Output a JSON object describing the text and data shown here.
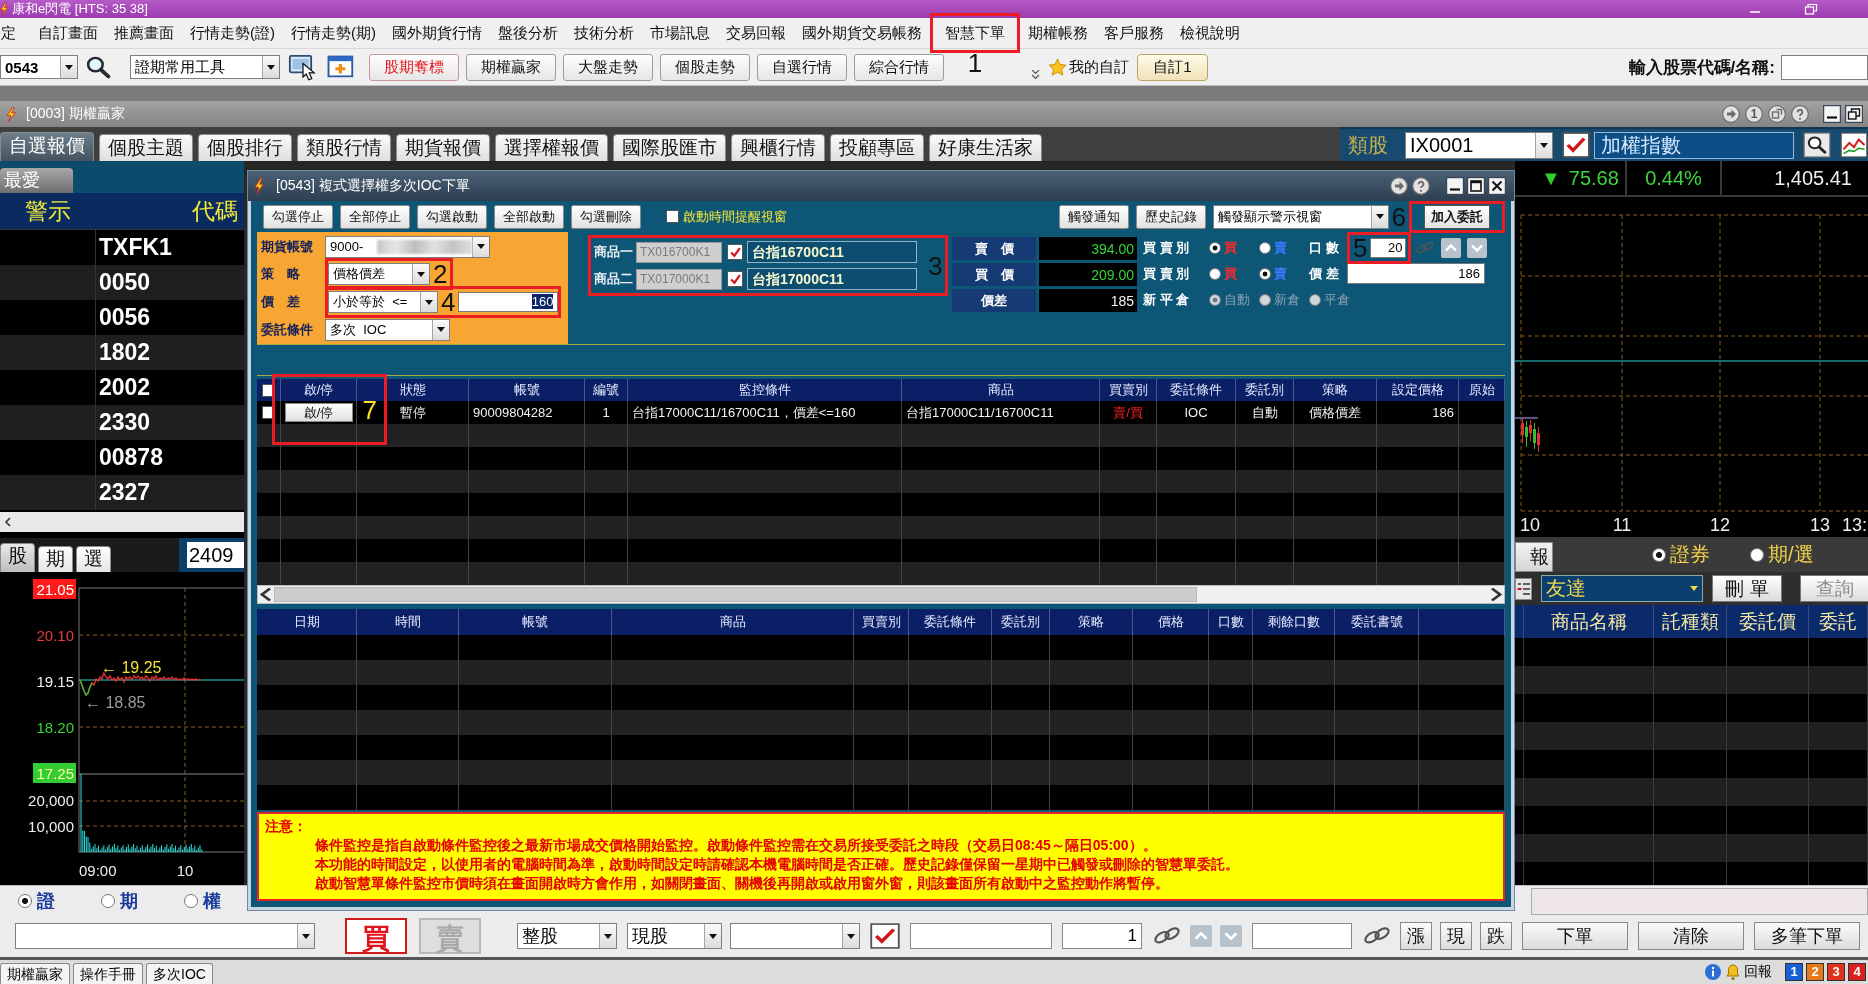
{
  "window": {
    "title": "康和e閃電 [HTS: 35 38]"
  },
  "menu": [
    {
      "label": "定"
    },
    {
      "label": "自訂畫面"
    },
    {
      "label": "推薦畫面"
    },
    {
      "label": "行情走勢(證)"
    },
    {
      "label": "行情走勢(期)"
    },
    {
      "label": "國外期貨行情"
    },
    {
      "label": "盤後分析"
    },
    {
      "label": "技術分析"
    },
    {
      "label": "市場訊息"
    },
    {
      "label": "交易回報"
    },
    {
      "label": "國外期貨交易帳務"
    },
    {
      "label": "智慧下單",
      "callout": "1"
    },
    {
      "label": "期權帳務"
    },
    {
      "label": "客戶服務"
    },
    {
      "label": "檢視說明"
    }
  ],
  "toolbar": {
    "code": "0543",
    "tool_set": "證期常用工具",
    "buttons": [
      {
        "label": "股期奪標",
        "kind": "highlight"
      },
      {
        "label": "期權贏家",
        "kind": "normal"
      },
      {
        "label": "大盤走勢",
        "kind": "normal"
      },
      {
        "label": "個股走勢",
        "kind": "normal"
      },
      {
        "label": "自選行情",
        "kind": "normal"
      },
      {
        "label": "綜合行情",
        "kind": "normal"
      }
    ],
    "favorites": "我的自訂",
    "custom_button": "自訂1",
    "search_label": "輸入股票代碼/名稱:"
  },
  "workspace": {
    "title": "[0003] 期權贏家",
    "badge": "1"
  },
  "tabs": [
    {
      "label": "自選報價",
      "selected": true
    },
    {
      "label": "個股主題",
      "selected": false
    },
    {
      "label": "個股排行",
      "selected": false
    },
    {
      "label": "類股行情",
      "selected": false
    },
    {
      "label": "期貨報價",
      "selected": false
    },
    {
      "label": "選擇權報價",
      "selected": false
    },
    {
      "label": "國際股匯市",
      "selected": false
    },
    {
      "label": "興櫃行情",
      "selected": false
    },
    {
      "label": "投顧專區",
      "selected": false
    },
    {
      "label": "好康生活家",
      "selected": false
    }
  ],
  "sector": {
    "label": "類股",
    "code": "IX0001",
    "name": "加權指數"
  },
  "watchlist": {
    "tab": "最愛",
    "columns": [
      "警示",
      "代碼"
    ],
    "rows": [
      {
        "code": "TXFK1"
      },
      {
        "code": "0050"
      },
      {
        "code": "0056"
      },
      {
        "code": "1802"
      },
      {
        "code": "2002"
      },
      {
        "code": "2330"
      },
      {
        "code": "00878"
      },
      {
        "code": "2327"
      }
    ]
  },
  "mini_chart": {
    "tabs": [
      {
        "label": "股",
        "selected": true
      },
      {
        "label": "期",
        "selected": false
      },
      {
        "label": "選",
        "selected": false
      }
    ],
    "code": "2409",
    "price_labels": [
      {
        "text": "21.05",
        "kind": "limit_up"
      },
      {
        "text": "20.10",
        "kind": "up"
      },
      {
        "text": "19.15",
        "kind": "flat"
      },
      {
        "text": "18.20",
        "kind": "down"
      },
      {
        "text": "17.25",
        "kind": "limit_down"
      }
    ],
    "volume_labels": [
      "20,000",
      "10,000"
    ],
    "time_labels": [
      "09:00",
      "10"
    ],
    "high_note": "← 19.25",
    "low_note": "← 18.85"
  },
  "quote": {
    "arrow": "▼",
    "change": "75.68",
    "percent": "0.44%",
    "value": "1,405.41"
  },
  "index_chart": {
    "time_labels": [
      "10",
      "11",
      "12",
      "13",
      "13:"
    ]
  },
  "orders": {
    "tab": "報",
    "markets": [
      {
        "label": "證券",
        "selected": true
      },
      {
        "label": "期/選",
        "selected": false
      }
    ],
    "broker": "友達",
    "buttons": [
      {
        "label": "刪 單",
        "disabled": false
      },
      {
        "label": "查詢",
        "disabled": true
      }
    ],
    "columns": [
      "商品名稱",
      "託種類",
      "委託價",
      "委託"
    ]
  },
  "dialog": {
    "title": "[0543] 複式選擇權多次IOC下單",
    "actions": [
      "勾選停止",
      "全部停止",
      "勾選啟動",
      "全部啟動",
      "勾選刪除"
    ],
    "reminder": {
      "label": "啟動時間提醒視窗",
      "checked": false
    },
    "notify": "觸發通知",
    "history": "歷史記錄",
    "alert_mode": "觸發顯示警示視窗",
    "add": {
      "label": "加入委託",
      "callout": "6"
    },
    "fields": [
      {
        "kind": "account",
        "label": "期貨帳號",
        "value": "9000-"
      },
      {
        "kind": "select",
        "label": "策　略",
        "value": "價格價差",
        "callout": "2"
      },
      {
        "kind": "condition",
        "label": "價　差",
        "value": "小於等於  <=",
        "input": "160",
        "input_selected": true,
        "callout": "4"
      },
      {
        "kind": "select",
        "label": "委託條件",
        "value": "多次  IOC"
      }
    ],
    "legs": {
      "callout": "3",
      "items": [
        {
          "label": "商品一",
          "code": "TX016700K1",
          "checked": true,
          "name": "台指16700C11"
        },
        {
          "label": "商品二",
          "code": "TX017000K1",
          "checked": true,
          "name": "台指17000C11"
        }
      ]
    },
    "prices": [
      {
        "kind": "quote",
        "label": "賣　價",
        "value": "394.00"
      },
      {
        "kind": "quote",
        "label": "買　價",
        "value": "209.00"
      },
      {
        "kind": "spread",
        "label": "價差",
        "value": "185"
      }
    ],
    "sides": [
      {
        "kind": "quantity",
        "label": "買 賣 別",
        "options": [
          {
            "label": "買",
            "selected": true
          },
          {
            "label": "賣",
            "selected": false
          }
        ],
        "field_label": "口 數",
        "field": "20",
        "callout": "5"
      },
      {
        "kind": "spread",
        "label": "買 賣 別",
        "options": [
          {
            "label": "買",
            "selected": false
          },
          {
            "label": "賣",
            "selected": true
          }
        ],
        "field_label": "價 差",
        "field": "186"
      }
    ],
    "position": {
      "label": "新 平 倉",
      "disabled": true,
      "options": [
        {
          "label": "自動",
          "selected": true
        },
        {
          "label": "新倉",
          "selected": false
        },
        {
          "label": "平倉",
          "selected": false
        }
      ]
    },
    "monitor": {
      "all_checked": false,
      "callout": "7",
      "columns": [
        "啟/停",
        "狀態",
        "帳號",
        "編號",
        "監控條件",
        "商品",
        "買賣別",
        "委託條件",
        "委託別",
        "策略",
        "設定價格",
        "原始"
      ],
      "rows": [
        {
          "checked": false,
          "cells": [
            "啟/停",
            "暫停",
            "90009804282",
            "1",
            "台指17000C11/16700C11，價差<=160",
            "台指17000C11/16700C11",
            "賣/買",
            "IOC",
            "自動",
            "價格價差",
            "186"
          ]
        }
      ]
    },
    "history_table": {
      "columns": [
        "日期",
        "時間",
        "帳號",
        "商品",
        "買賣別",
        "委託條件",
        "委託別",
        "策略",
        "價格",
        "口數",
        "剩餘口數",
        "委託書號"
      ]
    },
    "notice": {
      "title": "注意：",
      "lines": [
        "條件監控是指自啟動條件監控後之最新市場成交價格開始監控。啟動條件監控需在交易所接受委託之時段（交易日08:45～隔日05:00）。",
        "本功能的時間設定，以使用者的電腦時間為準，啟動時間設定時請確認本機電腦時間是否正確。歷史記錄僅保留一星期中已觸發或刪除的智慧單委託。",
        "啟動智慧單條件監控市價時須在畫面開啟時方會作用，如關閉畫面、關機後再開啟或啟用窗外窗，則該畫面所有啟動中之監控動作將暫停。"
      ]
    }
  },
  "order_bar": {
    "markets": [
      {
        "label": "證",
        "selected": true
      },
      {
        "label": "期",
        "selected": false
      },
      {
        "label": "權",
        "selected": false
      }
    ],
    "sides": [
      {
        "label": "買",
        "selected": true
      },
      {
        "label": "賣",
        "selected": false
      }
    ],
    "lot_type": "整股",
    "trade_type": "現股",
    "quantity": "1",
    "quick": [
      "漲",
      "現",
      "跌"
    ],
    "actions": [
      "下單",
      "清除",
      "多筆下單"
    ]
  },
  "taskbar": {
    "items": [
      "期權贏家",
      "操作手冊",
      "多次IOC"
    ],
    "report": "回報",
    "pages": [
      {
        "label": "1",
        "color": "#1a5fd6"
      },
      {
        "label": "2",
        "color": "#e8781a"
      },
      {
        "label": "3",
        "color": "#e0301c"
      },
      {
        "label": "4",
        "color": "#d8201c"
      }
    ]
  }
}
